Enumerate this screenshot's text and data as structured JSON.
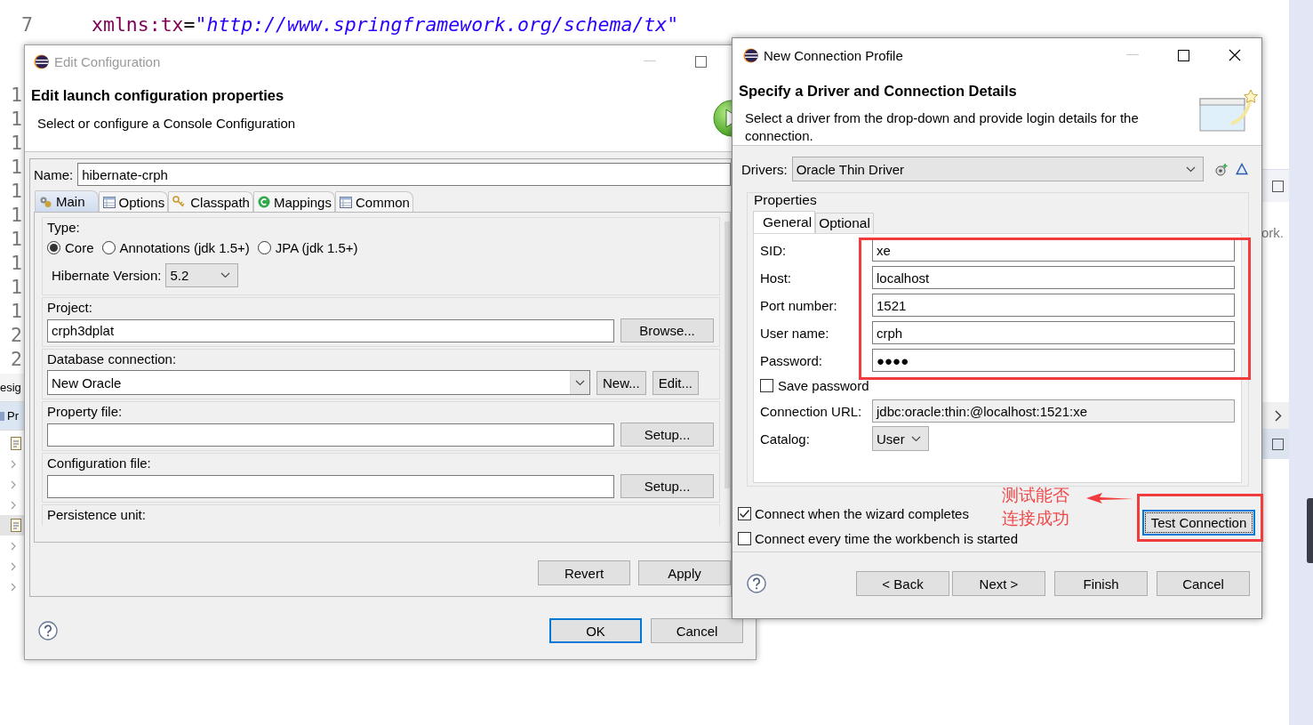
{
  "editor": {
    "code_lines": [
      {
        "number": "7",
        "attribute": "xmlns:tx",
        "equals": "=",
        "value": "\"http://www.springframework.org/schema/tx\""
      }
    ],
    "gutter_numbers": [
      "1",
      "1",
      "1",
      "1",
      "1",
      "1",
      "1",
      "1",
      "1",
      "1",
      "2",
      "2"
    ],
    "side_tabs": [
      {
        "label": "esig",
        "selected": false
      },
      {
        "label": "Pr",
        "selected": true
      }
    ],
    "side_text": "ork."
  },
  "edit_config": {
    "title": "Edit Configuration",
    "active": false,
    "heading": "Edit launch configuration properties",
    "description": "Select or configure a Console Configuration",
    "name_label": "Name:",
    "name_value": "hibernate-crph",
    "tabs": [
      {
        "label": "Main",
        "selected": true
      },
      {
        "label": "Options",
        "selected": false
      },
      {
        "label": "Classpath",
        "selected": false
      },
      {
        "label": "Mappings",
        "selected": false
      },
      {
        "label": "Common",
        "selected": false
      }
    ],
    "type_label": "Type:",
    "type_options": [
      {
        "label": "Core",
        "selected": true
      },
      {
        "label": "Annotations (jdk 1.5+)",
        "selected": false
      },
      {
        "label": "JPA (jdk 1.5+)",
        "selected": false
      }
    ],
    "version_label": "Hibernate Version:",
    "version_value": "5.2",
    "groups": [
      {
        "label": "Project:",
        "kind": "text",
        "value": "crph3dplat",
        "buttons": [
          "Browse..."
        ]
      },
      {
        "label": "Database connection:",
        "kind": "combo",
        "value": "New Oracle",
        "buttons": [
          "New...",
          "Edit..."
        ]
      },
      {
        "label": "Property file:",
        "kind": "text",
        "buttons": [
          "Setup..."
        ]
      },
      {
        "label": "Configuration file:",
        "kind": "text",
        "buttons": [
          "Setup..."
        ]
      },
      {
        "label": "Persistence unit:",
        "kind": "cut"
      }
    ],
    "action_buttons": [
      "Revert",
      "Apply"
    ],
    "dialog_buttons": [
      {
        "label": "OK",
        "default": true
      },
      {
        "label": "Cancel",
        "default": false
      }
    ]
  },
  "connection_profile": {
    "title": "New Connection Profile",
    "active": true,
    "heading": "Specify a Driver and Connection Details",
    "description": "Select a driver from the drop-down and provide login details for the connection.",
    "drivers_label": "Drivers:",
    "driver_value": "Oracle Thin Driver",
    "properties_label": "Properties",
    "tabs": [
      {
        "label": "General",
        "selected": true
      },
      {
        "label": "Optional",
        "selected": false
      }
    ],
    "fields": [
      {
        "kind": "text",
        "label": "SID:",
        "value": "xe"
      },
      {
        "kind": "text",
        "label": "Host:",
        "value": "localhost"
      },
      {
        "kind": "text",
        "label": "Port number:",
        "value": "1521"
      },
      {
        "kind": "text",
        "label": "User name:",
        "value": "crph"
      },
      {
        "kind": "text",
        "label": "Password:",
        "value": "●●●●"
      },
      {
        "kind": "checkbox",
        "label": "Save password",
        "checked": false
      },
      {
        "kind": "readonly",
        "label": "Connection URL:",
        "value": "jdbc:oracle:thin:@localhost:1521:xe"
      },
      {
        "kind": "combo",
        "label": "Catalog:",
        "value": "User"
      }
    ],
    "options": [
      {
        "label": "Connect when the wizard completes",
        "checked": true
      },
      {
        "label": "Connect every time the workbench is started",
        "checked": false
      }
    ],
    "test_button": {
      "label": "Test Connection",
      "focused": true
    },
    "buttons": [
      "< Back",
      "Next >",
      "Finish",
      "Cancel"
    ]
  },
  "annotations": {
    "note_lines": [
      "测试能否",
      "连接成功"
    ]
  }
}
